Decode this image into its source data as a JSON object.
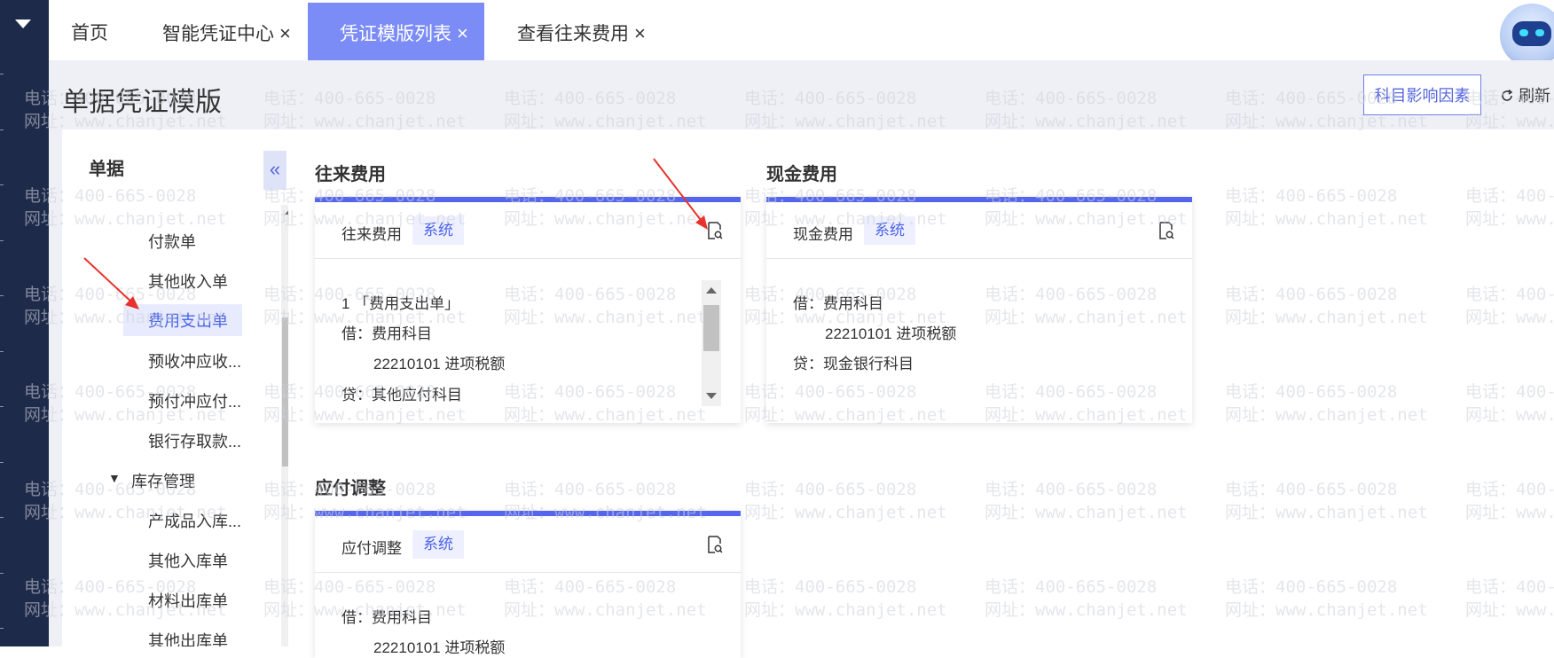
{
  "tabs": [
    {
      "label": "首页",
      "closable": false,
      "active": false
    },
    {
      "label": "智能凭证中心",
      "closable": true,
      "active": false
    },
    {
      "label": "凭证模版列表",
      "closable": true,
      "active": true
    },
    {
      "label": "查看往来费用",
      "closable": true,
      "active": false
    }
  ],
  "tab_close_glyph": "×",
  "window_close_glyph": "✕",
  "page": {
    "title": "单据凭证模版",
    "factors_button": "科目影响因素",
    "refresh_button": "刷新"
  },
  "tree": {
    "title": "单据",
    "items": [
      {
        "label": "付款单",
        "selected": false
      },
      {
        "label": "其他收入单",
        "selected": false
      },
      {
        "label": "费用支出单",
        "selected": true
      },
      {
        "label": "预收冲应收...",
        "selected": false
      },
      {
        "label": "预付冲应付...",
        "selected": false
      },
      {
        "label": "银行存取款...",
        "selected": false
      }
    ],
    "group": {
      "label": "库存管理",
      "expanded": true
    },
    "group_items": [
      {
        "label": "产成品入库..."
      },
      {
        "label": "其他入库单"
      },
      {
        "label": "材料出库单"
      },
      {
        "label": "其他出库单"
      }
    ]
  },
  "sections": [
    {
      "title": "往来费用",
      "card": {
        "name": "往来费用",
        "badge": "系统",
        "lines": [
          "1 「费用支出单」",
          "借：费用科目",
          "22210101 进项税额",
          "贷：其他应付科目"
        ]
      }
    },
    {
      "title": "现金费用",
      "card": {
        "name": "现金费用",
        "badge": "系统",
        "lines": [
          "借：费用科目",
          "22210101 进项税额",
          "贷：现金银行科目"
        ]
      }
    },
    {
      "title": "应付调整",
      "card": {
        "name": "应付调整",
        "badge": "系统",
        "lines": [
          "借：费用科目",
          "22210101 进项税额"
        ]
      }
    }
  ],
  "watermark": {
    "phone": "电话：400-665-0028",
    "site": "网址：www.chanjet.net"
  },
  "colors": {
    "accent": "#5566ee",
    "active_tab": "#7b8cf7",
    "sidebar": "#1e2a4a",
    "annotation_arrow": "#e8322d"
  }
}
